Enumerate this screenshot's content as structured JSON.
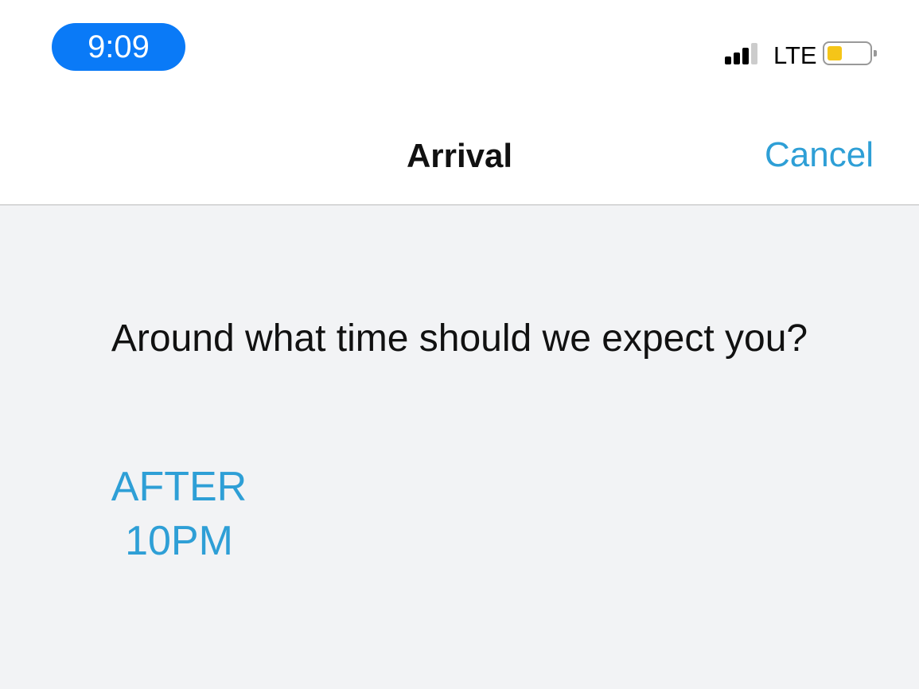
{
  "status": {
    "time": "9:09",
    "network": "LTE",
    "battery_level": 0.25
  },
  "nav": {
    "title": "Arrival",
    "cancel": "Cancel"
  },
  "main": {
    "question": "Around what time should we expect you?",
    "options": [
      {
        "line1": "AFTER",
        "line2": "10PM"
      }
    ]
  }
}
